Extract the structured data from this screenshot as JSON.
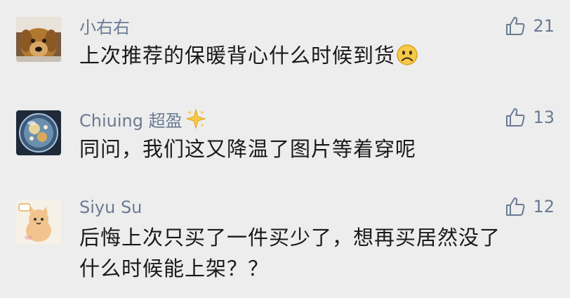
{
  "comments": [
    {
      "author": "小右右",
      "text": "上次推荐的保暖背心什么时候到货",
      "text_emoji": "frowning-face-emoji",
      "likes": "21",
      "avatar_icon": "dog-photo-avatar"
    },
    {
      "author": "Chiuing 超盈",
      "author_badge": "sparkling-star-emoji",
      "text": "同问，我们这又降温了图片等着穿呢",
      "likes": "13",
      "avatar_icon": "bubble-art-avatar"
    },
    {
      "author": "Siyu Su",
      "text_lines": [
        "后悔上次只买了一件买少了，想再买居然没了",
        "什么时候能上架？？"
      ],
      "likes": "12",
      "avatar_icon": "cartoon-cat-avatar"
    }
  ],
  "like_icon": "thumbs-up-icon",
  "colors": {
    "background": "#ededed",
    "author": "#6b7a93",
    "text": "#191919"
  }
}
